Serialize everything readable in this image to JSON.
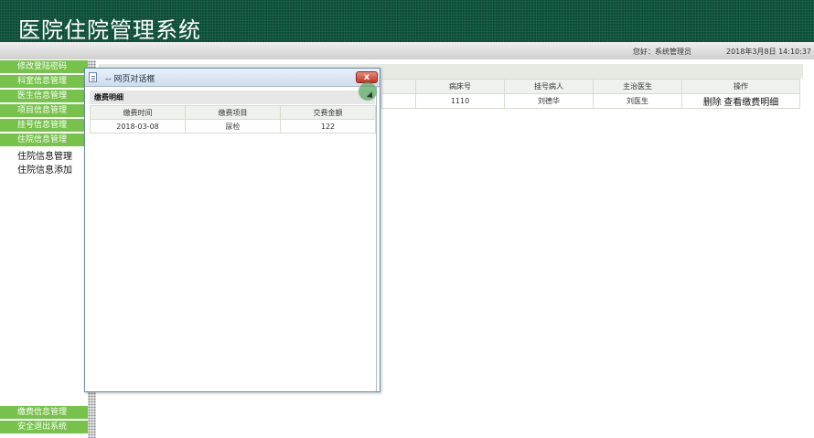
{
  "app": {
    "title": "医院住院管理系统"
  },
  "status": {
    "greeting": "您好：系统管理员",
    "datetime": "2018年3月8日  14:10:37"
  },
  "sidebar": {
    "items": [
      {
        "label": "修改登陆密码"
      },
      {
        "label": "科室信息管理"
      },
      {
        "label": "医生信息管理"
      },
      {
        "label": "项目信息管理"
      },
      {
        "label": "挂号信息管理"
      },
      {
        "label": "住院信息管理"
      }
    ],
    "sub_items": [
      {
        "label": "住院信息管理"
      },
      {
        "label": "住院信息添加"
      }
    ],
    "bottom_items": [
      {
        "label": "缴费信息管理"
      },
      {
        "label": "安全退出系统"
      }
    ]
  },
  "main": {
    "columns": [
      "病床号",
      "挂号病人",
      "主治医生",
      "操作"
    ],
    "rows": [
      {
        "bed": "1110",
        "patient": "刘德华",
        "doctor": "刘医生",
        "delete": "删除",
        "view": "查看缴费明细"
      }
    ]
  },
  "dialog": {
    "title": "-- 网页对话框",
    "close_label": "x",
    "section_label": "缴费明细",
    "columns": [
      "缴费时间",
      "缴费项目",
      "交费金额"
    ],
    "rows": [
      {
        "time": "2018-03-08",
        "item": "尿检",
        "amount": "122"
      }
    ]
  }
}
